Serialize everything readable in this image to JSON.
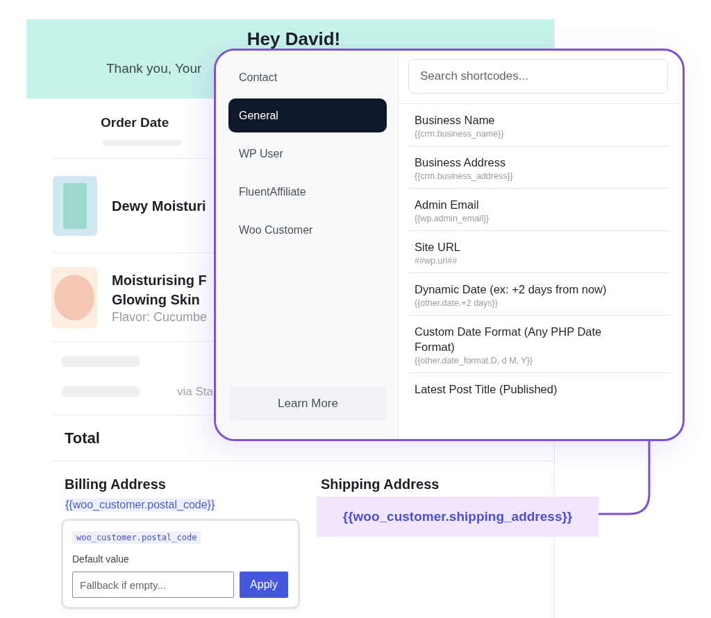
{
  "email": {
    "greeting": "Hey David!",
    "message": "Thank you, Your",
    "order_date_label": "Order Date",
    "items": [
      {
        "kind": "bar",
        "name_lines": [
          "Dewy Moisturi"
        ]
      },
      {
        "kind": "round",
        "name_lines": [
          "Moisturising F",
          "Glowing Skin"
        ],
        "variant": "Flavor: Cucumbe"
      }
    ],
    "summary_rows": [
      {
        "kind": "plain"
      },
      {
        "kind": "note",
        "note": "via Sta"
      }
    ],
    "total_label": "Total",
    "billing": {
      "heading": "Billing Address",
      "shortcode": "{{woo_customer.postal_code}}"
    },
    "shipping": {
      "heading": "Shipping Address",
      "shortcode": "{{woo_customer.shipping_address}}"
    }
  },
  "fallback_popover": {
    "tag": "woo_customer.postal_code",
    "label": "Default value",
    "placeholder": "Fallback if empty...",
    "button": "Apply"
  },
  "shortcode_picker": {
    "categories": [
      {
        "label": "Contact",
        "selected": false
      },
      {
        "label": "General",
        "selected": true
      },
      {
        "label": "WP User",
        "selected": false
      },
      {
        "label": "FluentAffiliate",
        "selected": false
      },
      {
        "label": "Woo Customer",
        "selected": false
      }
    ],
    "learn_more": "Learn More",
    "search": {
      "placeholder": "Search shortcodes..."
    },
    "shortcodes": [
      {
        "title": "Business Name",
        "code": "{{crm.business_name}}"
      },
      {
        "title": "Business Address",
        "code": "{{crm.business_address}}"
      },
      {
        "title": "Admin Email",
        "code": "{{wp.admin_email}}"
      },
      {
        "title": "Site URL",
        "code": "##wp.url##"
      },
      {
        "title": "Dynamic Date (ex: +2 days from now)",
        "code": "{{other.date.+2 days}}"
      },
      {
        "title": "Custom Date Format (Any PHP Date Format)",
        "code": "{{other.date_format.D, d M, Y}}"
      },
      {
        "title": "Latest Post Title (Published)"
      }
    ]
  }
}
